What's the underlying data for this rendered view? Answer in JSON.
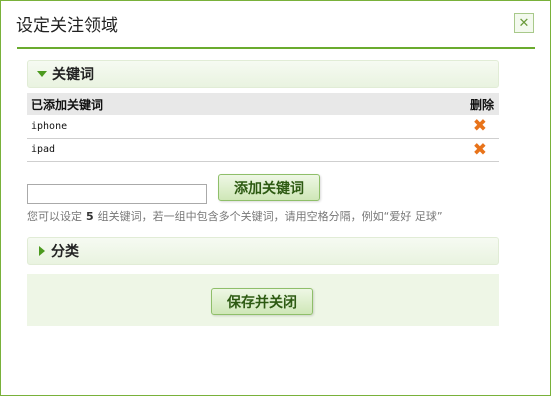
{
  "dialog": {
    "title": "设定关注领域",
    "close_icon": "close-icon"
  },
  "keywords_section": {
    "header": "关键词",
    "table_headers": {
      "added": "已添加关键词",
      "delete": "删除"
    },
    "rows": [
      {
        "keyword": "iphone"
      },
      {
        "keyword": "ipad"
      }
    ],
    "input_value": "",
    "add_button": "添加关键词",
    "hint_prefix": "您可以设定",
    "hint_count": "5",
    "hint_suffix": "组关键词，若一组中包含多个关键词，请用空格分隔，例如“爱好 足球”"
  },
  "category_section": {
    "header": "分类"
  },
  "footer": {
    "save_button": "保存并关闭"
  },
  "colors": {
    "accent": "#6aab2e",
    "delete": "#e8731a"
  }
}
